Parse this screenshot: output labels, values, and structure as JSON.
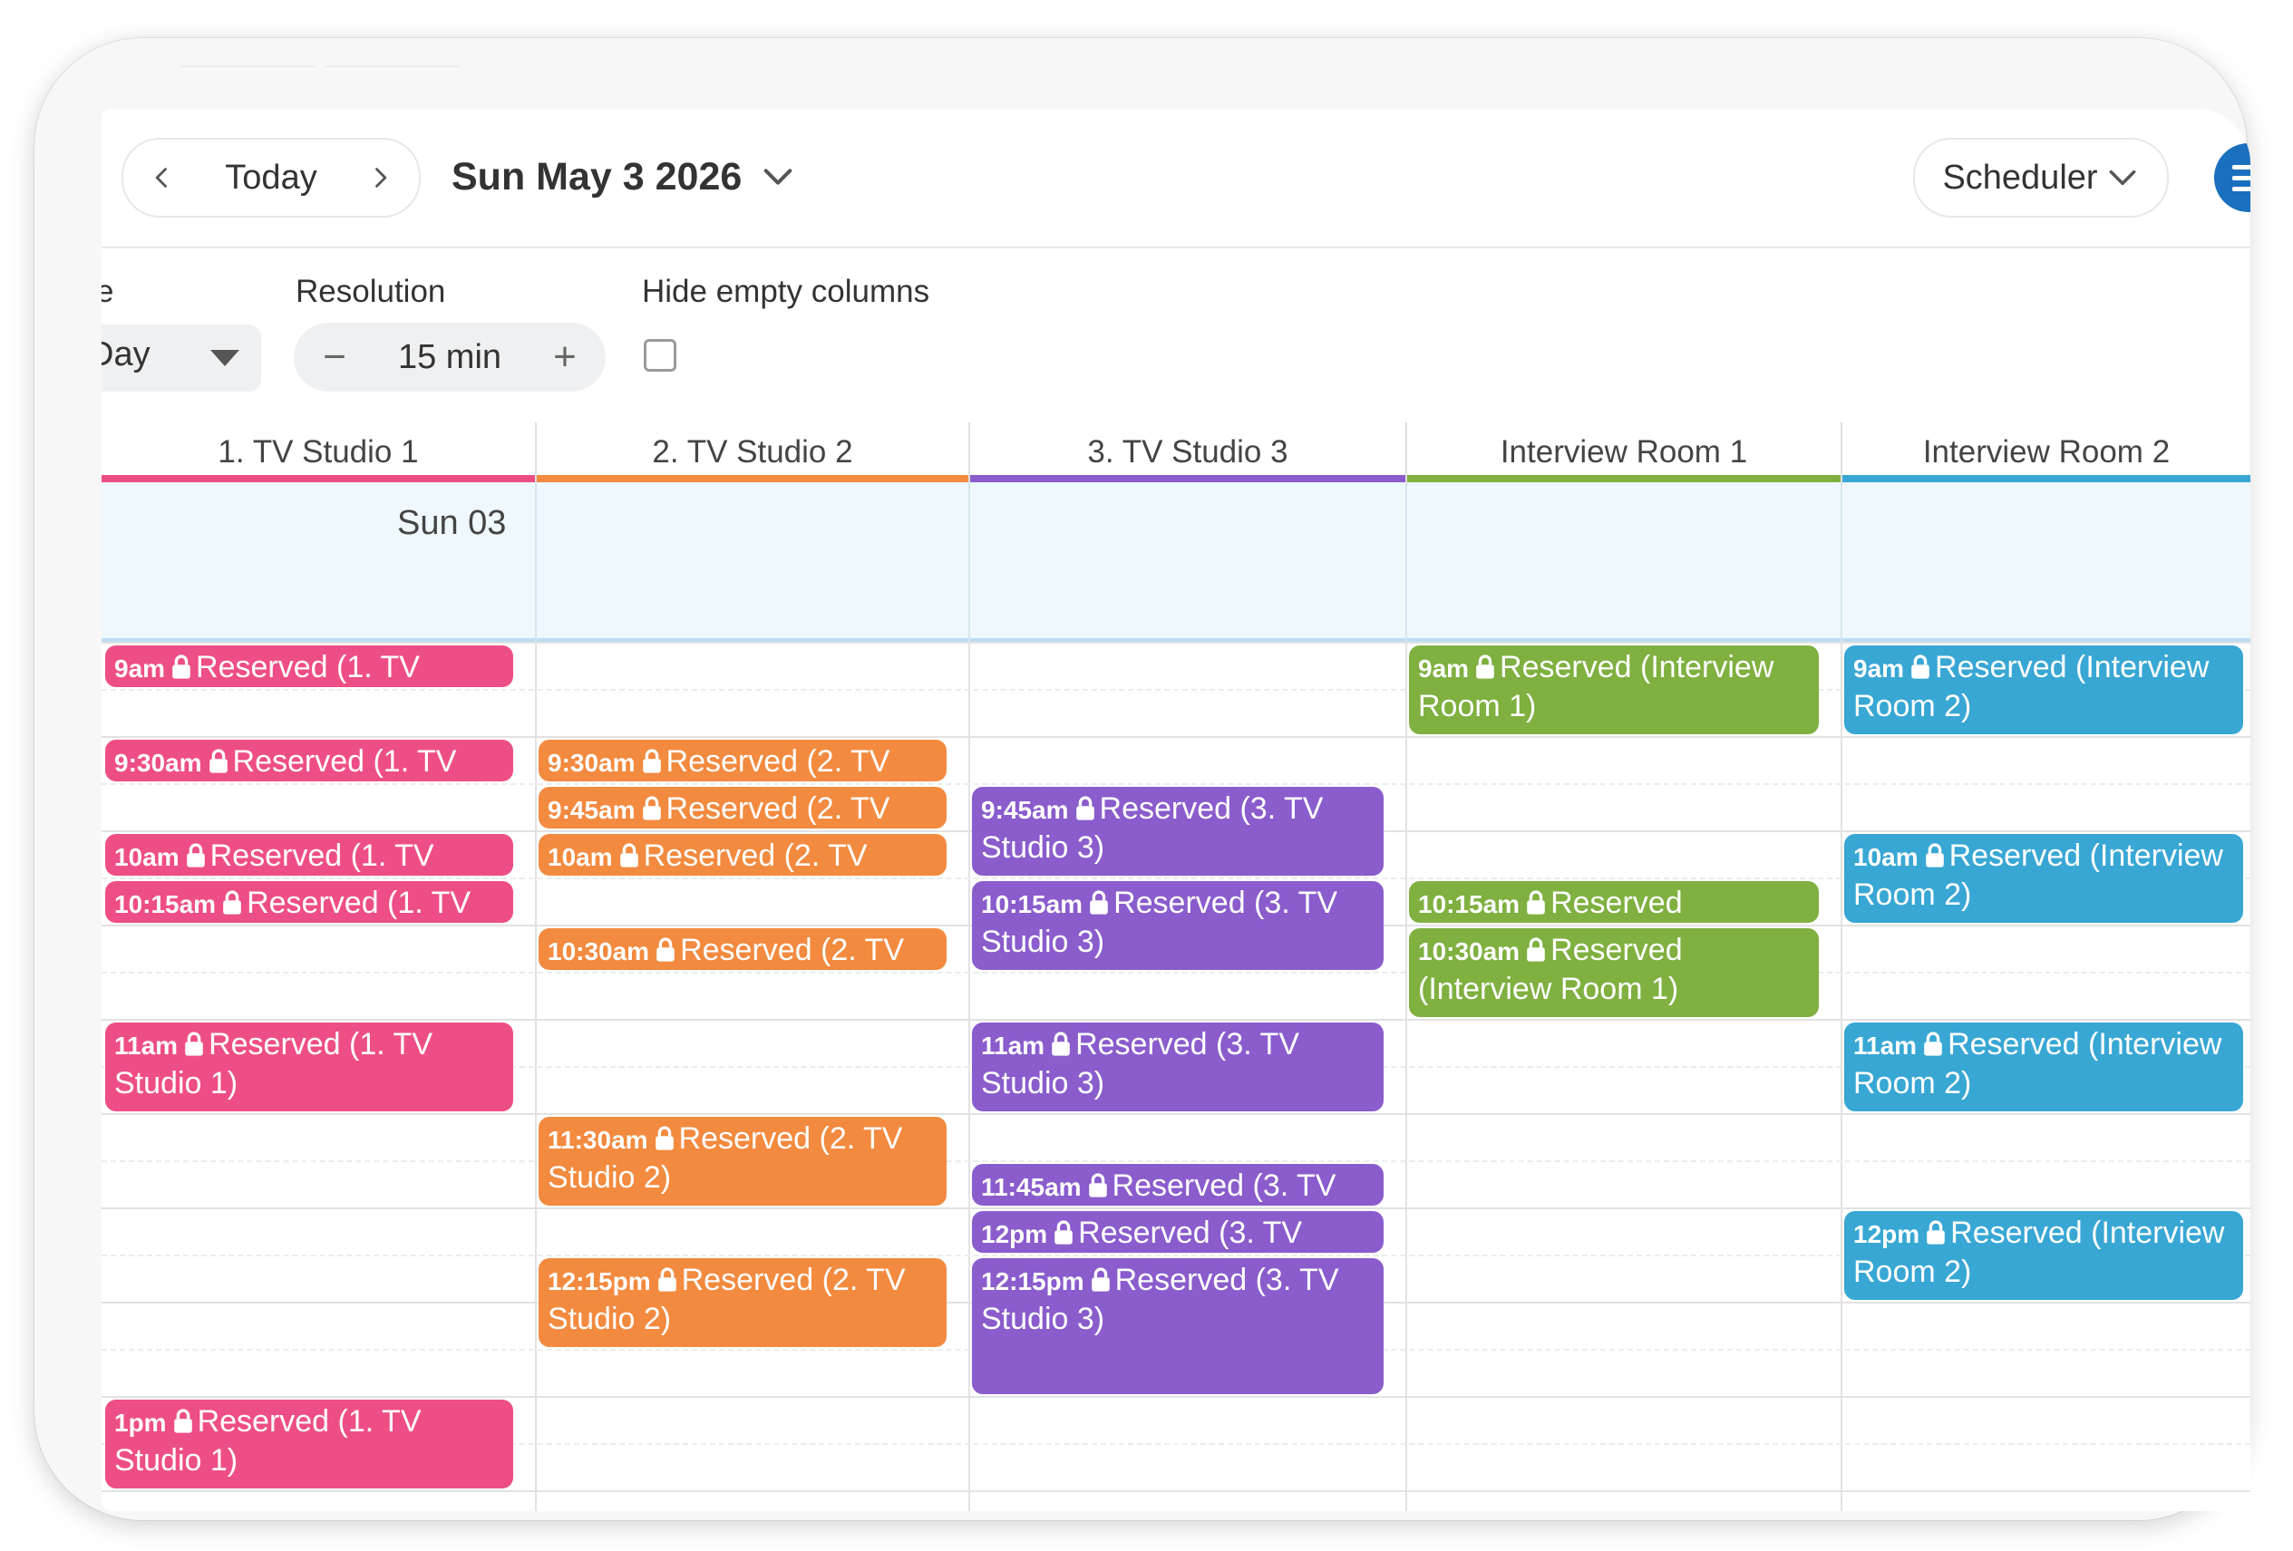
{
  "header": {
    "today_label": "Today",
    "date_title": "Sun May 3 2026",
    "view_switch_label": "Scheduler"
  },
  "filters": {
    "view_label": "e",
    "view_value": "Day",
    "resolution_label": "Resolution",
    "resolution_value": "15 min",
    "hide_empty_label": "Hide empty columns",
    "hide_empty_checked": false
  },
  "calendar": {
    "day_label": "Sun 03",
    "columns": [
      {
        "label": "1. TV Studio 1",
        "color": "#ee4e86"
      },
      {
        "label": "2. TV Studio 2",
        "color": "#f28a3f"
      },
      {
        "label": "3. TV Studio 3",
        "color": "#8a5ccc"
      },
      {
        "label": "Interview Room 1",
        "color": "#7fb040"
      },
      {
        "label": "Interview Room 2",
        "color": "#38a7d4"
      }
    ],
    "events": [
      {
        "time": "9am",
        "text": "Reserved (1. TV"
      },
      {
        "time": "9:30am",
        "text": "Reserved (1. TV"
      },
      {
        "time": "10am",
        "text": "Reserved (1. TV"
      },
      {
        "time": "10:15am",
        "text": "Reserved (1. TV"
      },
      {
        "time": "11am",
        "text": "Reserved (1. TV Studio 1)"
      },
      {
        "time": "1pm",
        "text": "Reserved (1. TV Studio 1)"
      },
      {
        "time": "9:30am",
        "text": "Reserved (2. TV"
      },
      {
        "time": "9:45am",
        "text": "Reserved (2. TV"
      },
      {
        "time": "10am",
        "text": "Reserved (2. TV"
      },
      {
        "time": "10:30am",
        "text": "Reserved (2. TV"
      },
      {
        "time": "11:30am",
        "text": "Reserved (2. TV Studio 2)"
      },
      {
        "time": "12:15pm",
        "text": "Reserved (2. TV Studio 2)"
      },
      {
        "time": "9:45am",
        "text": "Reserved (3. TV Studio 3)"
      },
      {
        "time": "10:15am",
        "text": "Reserved (3. TV Studio 3)"
      },
      {
        "time": "11am",
        "text": "Reserved (3. TV Studio 3)"
      },
      {
        "time": "11:45am",
        "text": "Reserved (3. TV"
      },
      {
        "time": "12pm",
        "text": "Reserved (3. TV"
      },
      {
        "time": "12:15pm",
        "text": "Reserved (3. TV Studio 3)"
      },
      {
        "time": "9am",
        "text": "Reserved (Interview Room 1)"
      },
      {
        "time": "10:15am",
        "text": "Reserved"
      },
      {
        "time": "10:30am",
        "text": "Reserved (Interview Room 1)"
      },
      {
        "time": "9am",
        "text": "Reserved (Interview Room 2)"
      },
      {
        "time": "10am",
        "text": "Reserved (Interview Room 2)"
      },
      {
        "time": "11am",
        "text": "Reserved (Interview Room 2)"
      },
      {
        "time": "12pm",
        "text": "Reserved (Interview Room 2)"
      }
    ]
  }
}
